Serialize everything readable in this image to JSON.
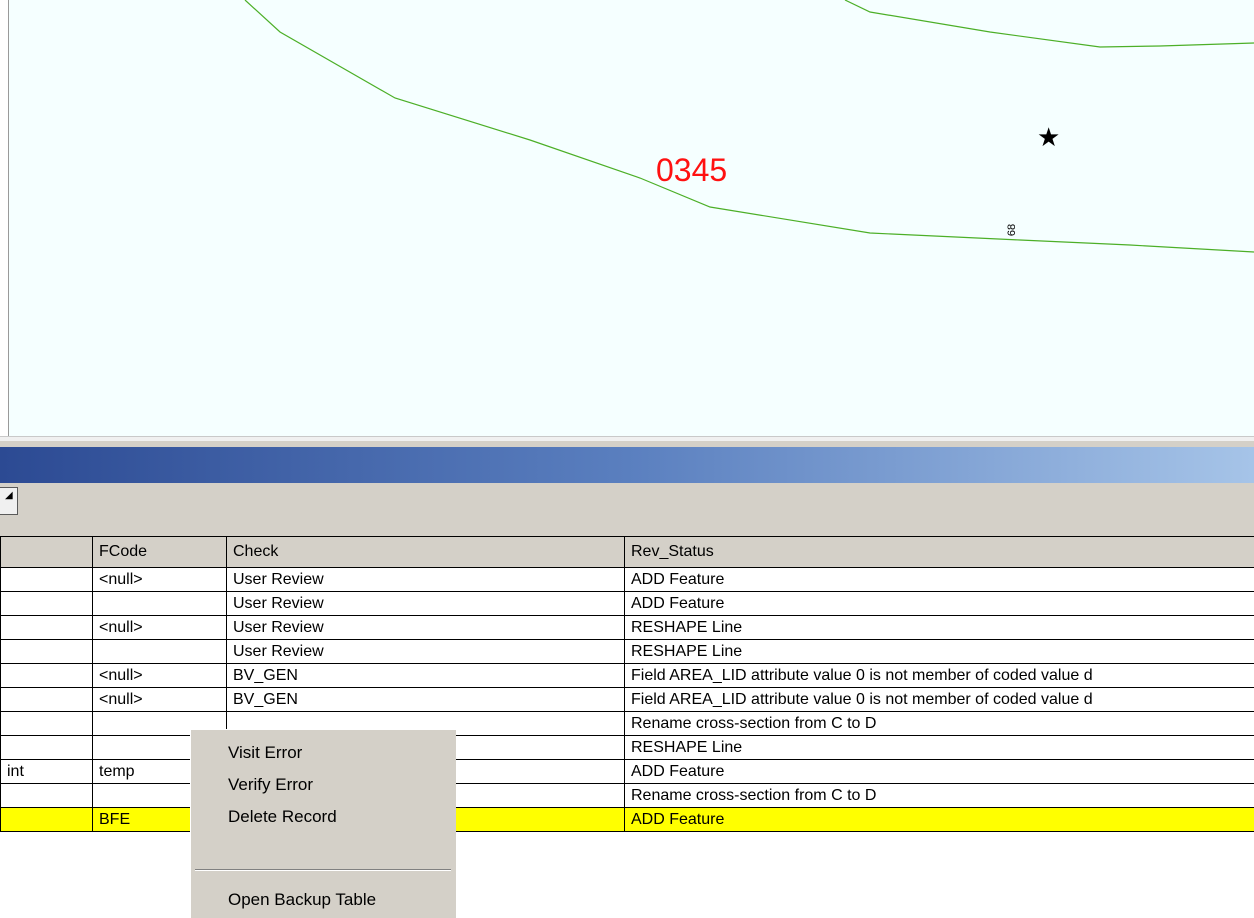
{
  "map": {
    "label_main": "0345",
    "label_small": "68",
    "marker_icon": "star-icon",
    "line_color": "#4caf27",
    "label_color": "#ff1111"
  },
  "toolbar": {
    "button_icon": "dropdown-arrow-icon"
  },
  "table": {
    "columns": [
      "",
      "FCode",
      "Check",
      "Rev_Status"
    ],
    "rows": [
      {
        "c0": "",
        "fcode": "<null>",
        "check": "User Review",
        "rev_status": "ADD Feature",
        "selected": false
      },
      {
        "c0": "",
        "fcode": "",
        "check": "User Review",
        "rev_status": "ADD Feature",
        "selected": false
      },
      {
        "c0": "",
        "fcode": "<null>",
        "check": "User Review",
        "rev_status": "RESHAPE Line",
        "selected": false
      },
      {
        "c0": "",
        "fcode": "",
        "check": "User Review",
        "rev_status": "RESHAPE Line",
        "selected": false
      },
      {
        "c0": "",
        "fcode": "<null>",
        "check": "BV_GEN",
        "rev_status": "Field AREA_LID attribute value    0 is not member of coded value d",
        "selected": false
      },
      {
        "c0": "",
        "fcode": "<null>",
        "check": "BV_GEN",
        "rev_status": "Field AREA_LID attribute value    0 is not member of coded value d",
        "selected": false
      },
      {
        "c0": "",
        "fcode": "",
        "check": "",
        "rev_status": "Rename cross-section from C to D",
        "selected": false
      },
      {
        "c0": "",
        "fcode": "",
        "check": "",
        "rev_status": "RESHAPE Line",
        "selected": false
      },
      {
        "c0": "int",
        "fcode": "temp",
        "check": "",
        "rev_status": "ADD Feature",
        "selected": false
      },
      {
        "c0": "",
        "fcode": "",
        "check": "",
        "rev_status": "Rename cross-section from C to D",
        "selected": false
      },
      {
        "c0": "",
        "fcode": "BFE",
        "check": "",
        "rev_status": "ADD Feature",
        "selected": true
      }
    ],
    "selected_color": "#ffff00"
  },
  "context_menu": {
    "items": [
      "Visit Error",
      "Verify Error",
      "Delete Record",
      "Open Backup Table"
    ]
  }
}
